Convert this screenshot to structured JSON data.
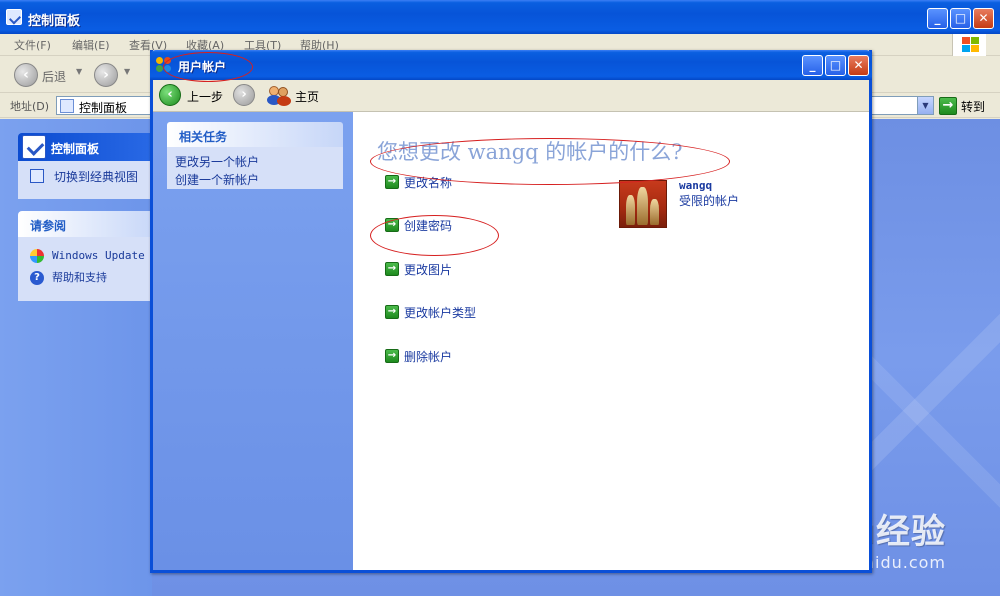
{
  "outer_window": {
    "title": "控制面板",
    "controls": {
      "minimize": "_",
      "maximize": "□",
      "close": "✕"
    }
  },
  "menubar": [
    "文件(F)",
    "编辑(E)",
    "查看(V)",
    "收藏(A)",
    "工具(T)",
    "帮助(H)"
  ],
  "toolbar": {
    "back_label": "后退"
  },
  "address_bar": {
    "label": "地址(D)",
    "value": "控制面板",
    "go_label": "转到"
  },
  "control_panel_box": {
    "title": "控制面板",
    "switch_view": "切换到经典视图"
  },
  "see_also": {
    "title": "请参阅",
    "items": [
      "Windows Update",
      "帮助和支持"
    ]
  },
  "dialog": {
    "title": "用户帐户",
    "controls": {
      "minimize": "_",
      "maximize": "□",
      "close": "✕"
    },
    "toolbar": {
      "back": "上一步",
      "home": "主页"
    },
    "related_tasks": {
      "title": "相关任务",
      "items": [
        "更改另一个帐户",
        "创建一个新帐户"
      ]
    },
    "heading": "您想更改 wangq 的帐户的什么?",
    "actions": [
      "更改名称",
      "创建密码",
      "更改图片",
      "更改帐户类型",
      "删除帐户"
    ],
    "user": {
      "name": "wangq",
      "account_type": "受限的帐户"
    }
  },
  "watermark": {
    "line1": "Baidu经验",
    "line2": "jingyan.baidu.com"
  },
  "colors": {
    "title_blue": "#0754d8",
    "link_blue": "#1a3aa0",
    "heading_blue": "#8aa4d8",
    "annotation_red": "#d62020"
  }
}
